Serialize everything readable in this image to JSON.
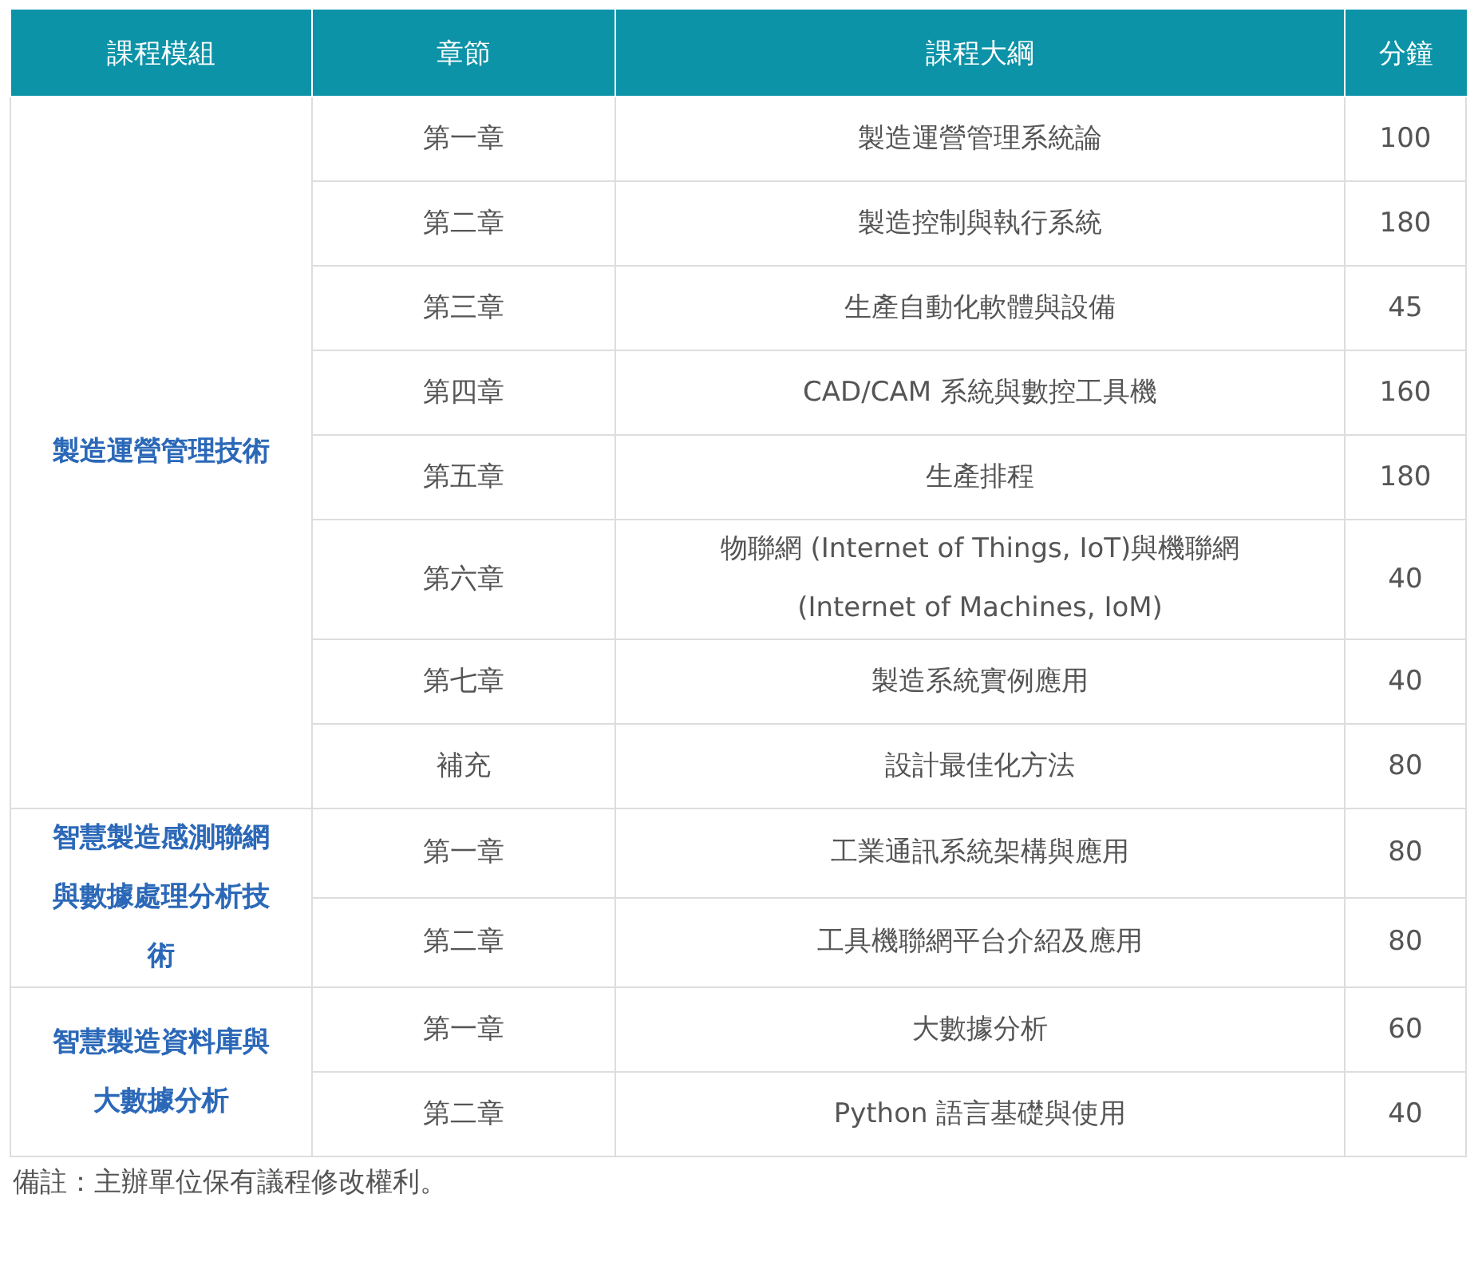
{
  "table": {
    "columns": [
      "課程模組",
      "章節",
      "課程大綱",
      "分鐘"
    ],
    "groups": [
      {
        "module": "製造運營管理技術",
        "rows": [
          {
            "chapter": "第一章",
            "outline": "製造運營管理系統論",
            "minutes": "100"
          },
          {
            "chapter": "第二章",
            "outline": "製造控制與執行系統",
            "minutes": "180"
          },
          {
            "chapter": "第三章",
            "outline": "生產自動化軟體與設備",
            "minutes": "45"
          },
          {
            "chapter": "第四章",
            "outline": "CAD/CAM 系統與數控工具機",
            "minutes": "160"
          },
          {
            "chapter": "第五章",
            "outline": "生產排程",
            "minutes": "180"
          },
          {
            "chapter": "第六章",
            "outline": "物聯網 (Internet of Things, IoT)與機聯網 (Internet of Machines, IoM)",
            "minutes": "40"
          },
          {
            "chapter": "第七章",
            "outline": "製造系統實例應用",
            "minutes": "40"
          },
          {
            "chapter": "補充",
            "outline": "設計最佳化方法",
            "minutes": "80"
          }
        ]
      },
      {
        "module": "智慧製造感測聯網與數據處理分析技術",
        "rows": [
          {
            "chapter": "第一章",
            "outline": "工業通訊系統架構與應用",
            "minutes": "80"
          },
          {
            "chapter": "第二章",
            "outline": "工具機聯網平台介紹及應用",
            "minutes": "80"
          }
        ]
      },
      {
        "module": "智慧製造資料庫與大數據分析",
        "rows": [
          {
            "chapter": "第一章",
            "outline": "大數據分析",
            "minutes": "60"
          },
          {
            "chapter": "第二章",
            "outline": "Python 語言基礎與使用",
            "minutes": "40"
          }
        ]
      }
    ]
  },
  "note": "備註：主辦單位保有議程修改權利。"
}
